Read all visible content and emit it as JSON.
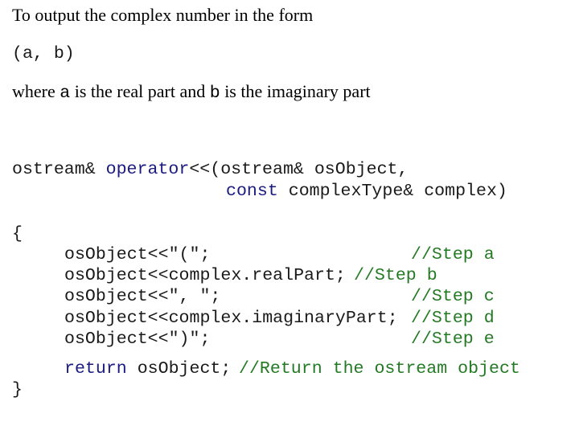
{
  "intro": {
    "line1": "To output the complex number in the form",
    "form": "(a, b)",
    "where_prefix": "where ",
    "var_a": "a",
    "where_mid": " is the real part and ",
    "var_b": "b",
    "where_suffix": " is the imaginary part"
  },
  "code": {
    "sig1_type": "ostream& ",
    "sig1_kw": "operator",
    "sig1_rest": "<<(ostream& osObject,",
    "sig2_kw": "const",
    "sig2_rest": " complexType& complex)",
    "open_brace": "{",
    "steps": [
      {
        "code": "osObject<<\"(\";",
        "comment": "//Step a"
      },
      {
        "code": "osObject<<complex.realPart;",
        "comment": "//Step b"
      },
      {
        "code": "osObject<<\", \";",
        "comment": "//Step c"
      },
      {
        "code": "osObject<<complex.imaginaryPart;",
        "comment": "//Step d"
      },
      {
        "code": "osObject<<\")\";",
        "comment": "//Step e"
      }
    ],
    "return_kw": "return",
    "return_rest": " osObject;",
    "return_comment": "//Return the ostream object",
    "close_brace": "}"
  },
  "colors": {
    "keyword": "#1a1a80",
    "comment": "#237a23",
    "text": "#1a1a1a"
  }
}
